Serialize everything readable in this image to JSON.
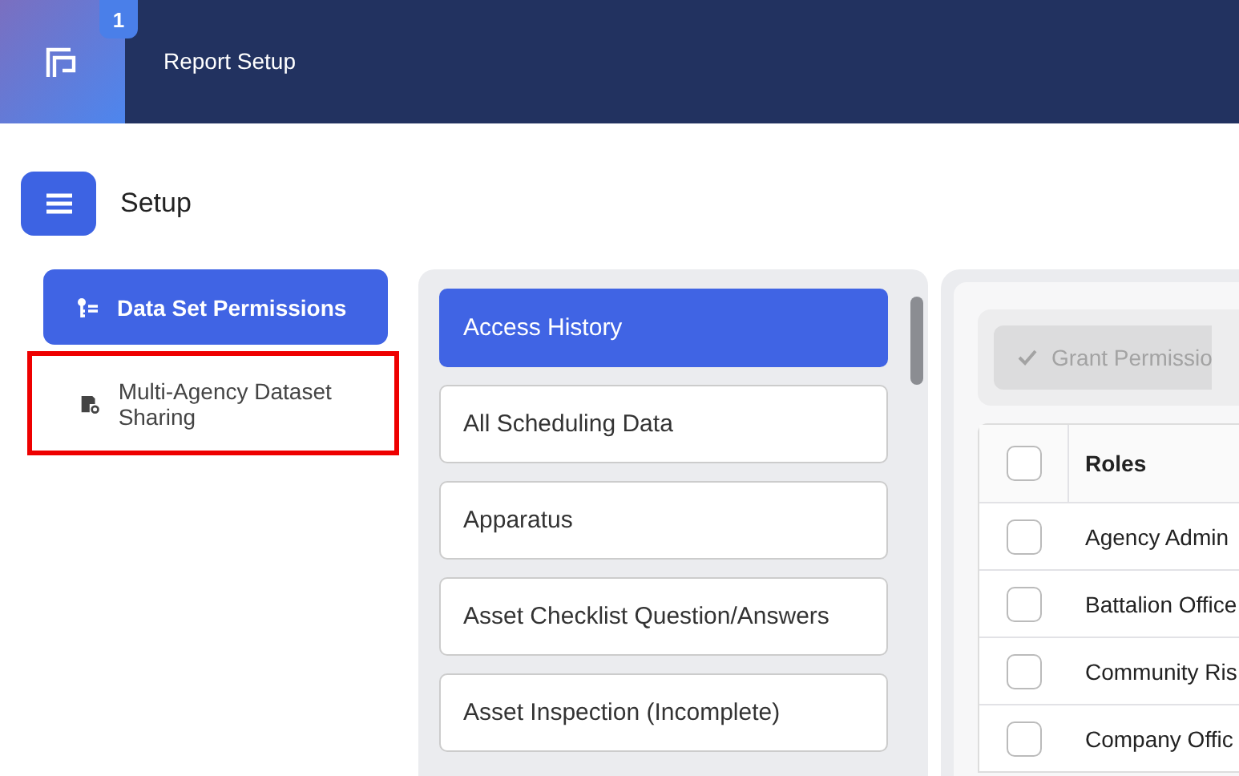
{
  "header": {
    "badge": "1",
    "title": "Report Setup"
  },
  "page": {
    "title": "Setup"
  },
  "nav": [
    {
      "label": "Data Set Permissions",
      "selected": true,
      "highlighted": false
    },
    {
      "label": "Multi-Agency Dataset Sharing",
      "selected": false,
      "highlighted": true
    }
  ],
  "datasets": [
    {
      "label": "Access History",
      "selected": true
    },
    {
      "label": "All Scheduling Data",
      "selected": false
    },
    {
      "label": "Apparatus",
      "selected": false
    },
    {
      "label": "Asset Checklist Question/Answers",
      "selected": false
    },
    {
      "label": "Asset Inspection (Incomplete)",
      "selected": false
    }
  ],
  "grant_button": {
    "label": "Grant Permissio",
    "disabled": true
  },
  "table": {
    "header": {
      "label": "Roles",
      "checked": false
    },
    "rows": [
      {
        "label": "Agency Admin",
        "checked": false
      },
      {
        "label": "Battalion Office",
        "checked": false
      },
      {
        "label": "Community Ris",
        "checked": false
      },
      {
        "label": "Company Offic",
        "checked": false
      }
    ]
  }
}
